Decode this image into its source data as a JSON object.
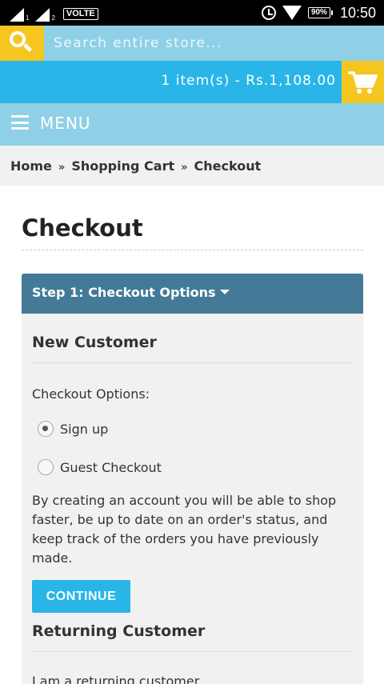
{
  "status_bar": {
    "sim1": "1",
    "sim2": "2",
    "network": "VOLTE",
    "battery": "90%",
    "time": "10:50",
    "icons": [
      "signal-icon",
      "alarm-icon",
      "wifi-icon",
      "battery-icon"
    ]
  },
  "search": {
    "placeholder": "Search entire store...",
    "icon": "search-icon"
  },
  "cart": {
    "summary": "1 item(s) - Rs.1,108.00",
    "icon": "cart-icon"
  },
  "menu": {
    "label": "MENU",
    "icon": "hamburger-icon"
  },
  "breadcrumb": {
    "items": [
      "Home",
      "Shopping Cart",
      "Checkout"
    ],
    "separator": "»"
  },
  "page": {
    "title": "Checkout"
  },
  "step1": {
    "heading": "Step 1: Checkout Options",
    "new_customer": {
      "title": "New Customer",
      "options_label": "Checkout Options:",
      "options": [
        {
          "label": "Sign up",
          "checked": true
        },
        {
          "label": "Guest Checkout",
          "checked": false
        }
      ],
      "description": "By creating an account you will be able to shop faster, be up to date on an order's status, and keep track of the orders you have previously made.",
      "continue_label": "CONTINUE"
    },
    "returning_customer": {
      "title": "Returning Customer",
      "text": "I am a returning customer"
    }
  },
  "colors": {
    "accent_blue": "#29b5e8",
    "light_blue": "#8fd0e6",
    "yellow": "#f4c61f",
    "panel_heading": "#447a97"
  }
}
